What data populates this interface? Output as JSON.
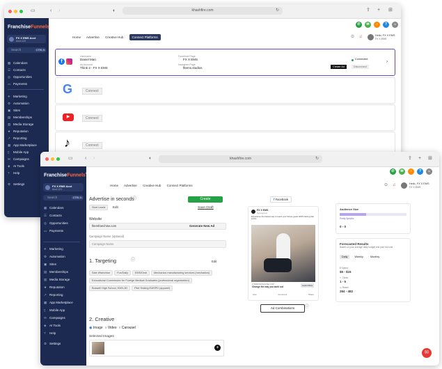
{
  "colors": {
    "sidebar": "#1c2a52",
    "accent": "#27a145",
    "highlight": "#5a4bd1"
  },
  "back": {
    "url": "khashfire.com",
    "logo": {
      "main": "Franchise",
      "accent": "Funnels",
      "sup": "®"
    },
    "account": {
      "name": "FX X EMS Acct",
      "sub": "Acct-123"
    },
    "search": {
      "label": "Search",
      "shortcut": "CTRL K"
    },
    "nav": [
      {
        "label": "Calendars",
        "icon": "calendar-icon",
        "glyph": "▦"
      },
      {
        "label": "Contacts",
        "icon": "contacts-icon",
        "glyph": "☰"
      },
      {
        "label": "Opportunities",
        "icon": "opportunities-icon",
        "glyph": "◎"
      },
      {
        "label": "Payments",
        "icon": "payments-icon",
        "glyph": "▭"
      },
      {
        "label": "Marketing",
        "icon": "marketing-icon",
        "glyph": "✈"
      },
      {
        "label": "Automation",
        "icon": "automation-icon",
        "glyph": "⚙"
      },
      {
        "label": "Sites",
        "icon": "sites-icon",
        "glyph": "▣"
      },
      {
        "label": "Memberships",
        "icon": "memberships-icon",
        "glyph": "▤"
      },
      {
        "label": "Media Storage",
        "icon": "media-storage-icon",
        "glyph": "▥"
      },
      {
        "label": "Reputation",
        "icon": "reputation-icon",
        "glyph": "★"
      },
      {
        "label": "Reporting",
        "icon": "reporting-icon",
        "glyph": "↗"
      },
      {
        "label": "App Marketplace",
        "icon": "app-marketplace-icon",
        "glyph": "▦"
      },
      {
        "label": "Mobile App",
        "icon": "mobile-app-icon",
        "glyph": "▯"
      },
      {
        "label": "Campaigns",
        "icon": "campaigns-icon",
        "glyph": "✉"
      },
      {
        "label": "AI Tools",
        "icon": "ai-tools-icon",
        "glyph": "◈"
      },
      {
        "label": "Help",
        "icon": "help-icon",
        "glyph": "?"
      },
      {
        "label": "Settings",
        "icon": "settings-icon",
        "glyph": "⚙"
      }
    ],
    "topnav": [
      "Home",
      "Advertise",
      "Creative Hub",
      "Connect Platforms"
    ],
    "user": {
      "greet": "Hello, FX X EMS",
      "sub": "FX X EMS"
    },
    "fb_card": {
      "username_label": "Username",
      "username": "Daniel Mari",
      "adaccount_label": "Ad Account",
      "adaccount": "Think 3 - FX X EMS",
      "fbpage_label": "Facebook Page",
      "fbpage": "FX X EMS",
      "igpage_label": "Instagram Page",
      "igpage": "fitems.studios",
      "status": "Connected",
      "create_ad": "Create Ad",
      "disconnect": "Disconnect"
    },
    "connect": "Connect"
  },
  "front": {
    "url": "khashfire.com",
    "logo": {
      "main": "Franchise",
      "accent": "Funnels",
      "sup": "®"
    },
    "account": {
      "name": "FX X EMS Acct",
      "sub": "Acct-123"
    },
    "search": {
      "label": "Search",
      "shortcut": "CTRL K"
    },
    "nav": [
      {
        "label": "Calendars",
        "icon": "calendar-icon",
        "glyph": "▦"
      },
      {
        "label": "Contacts",
        "icon": "contacts-icon",
        "glyph": "☰"
      },
      {
        "label": "Opportunities",
        "icon": "opportunities-icon",
        "glyph": "◎"
      },
      {
        "label": "Payments",
        "icon": "payments-icon",
        "glyph": "▭"
      },
      {
        "label": "Marketing",
        "icon": "marketing-icon",
        "glyph": "✈"
      },
      {
        "label": "Automation",
        "icon": "automation-icon",
        "glyph": "⚙"
      },
      {
        "label": "Sites",
        "icon": "sites-icon",
        "glyph": "▣"
      },
      {
        "label": "Memberships",
        "icon": "memberships-icon",
        "glyph": "▤"
      },
      {
        "label": "Media Storage",
        "icon": "media-storage-icon",
        "glyph": "▥"
      },
      {
        "label": "Reputation",
        "icon": "reputation-icon",
        "glyph": "★"
      },
      {
        "label": "Reporting",
        "icon": "reporting-icon",
        "glyph": "↗"
      },
      {
        "label": "App Marketplace",
        "icon": "app-marketplace-icon",
        "glyph": "▦"
      },
      {
        "label": "Mobile App",
        "icon": "mobile-app-icon",
        "glyph": "▯"
      },
      {
        "label": "Campaigns",
        "icon": "campaigns-icon",
        "glyph": "✉"
      },
      {
        "label": "AI Tools",
        "icon": "ai-tools-icon",
        "glyph": "◈"
      },
      {
        "label": "Help",
        "icon": "help-icon",
        "glyph": "?"
      },
      {
        "label": "Settings",
        "icon": "settings-icon",
        "glyph": "⚙"
      }
    ],
    "topnav": [
      "Home",
      "Advertise",
      "Creative Hub",
      "Connect Platforms"
    ],
    "user": {
      "greet": "Hello, FX X EMS",
      "sub": "FX X EMS"
    },
    "editor": {
      "title": "Advertise in seconds",
      "create": "Create",
      "save_draft": "Save Draft",
      "start_leads": "Start Leads",
      "edit": "Edit",
      "website_label": "Website",
      "website": "fitemfranchise.com",
      "generate": "Generate New Ad",
      "campaign_label": "Campaign Name (optional)",
      "campaign_placeholder": "Campaign Name",
      "targeting": "1.  Targeting",
      "targeting_edit": "Edit",
      "chips": [
        "Sale #franchise",
        "Fox/Daily",
        "EMS/Deal",
        "Mechanics manufacturing services (mechanics)",
        "Educational Commission for Foreign Medical Graduates (professional organization)",
        "Boswell High School, EMS-3D",
        "Pilot Testing EMSPD (apparel)"
      ],
      "creative": "2.  Creative",
      "media": [
        "Image",
        "Video",
        "Carousel"
      ],
      "selected_images": "Selected Images"
    },
    "preview": {
      "tab": "Facebook",
      "page": "FX X EMS",
      "sponsored": "Sponsored",
      "text": "Experience the fastest way to reach your fitness goals. EMS training that works.",
      "site": "FITEMFRANCHISE.COM",
      "headline": "Change the way you work out",
      "cta": "Learn More",
      "actions": [
        "Like",
        "Comment",
        "Share"
      ],
      "ad_combos": "Ad Combinations"
    },
    "audience": {
      "title": "Audience Size",
      "bar": "Pretty Specific",
      "range": "0 - 0"
    },
    "results": {
      "title": "Forecasted Results",
      "desc": "Based on your average daily budget and your bid cost",
      "tabs": [
        "Daily",
        "Weekly",
        "Monthly"
      ],
      "spend_label": "Spend",
      "spend": "$5 - $15",
      "clicks_label": "Clicks",
      "clicks": "1 - 5",
      "reach_label": "Reach",
      "reach": "284 - 482"
    }
  }
}
